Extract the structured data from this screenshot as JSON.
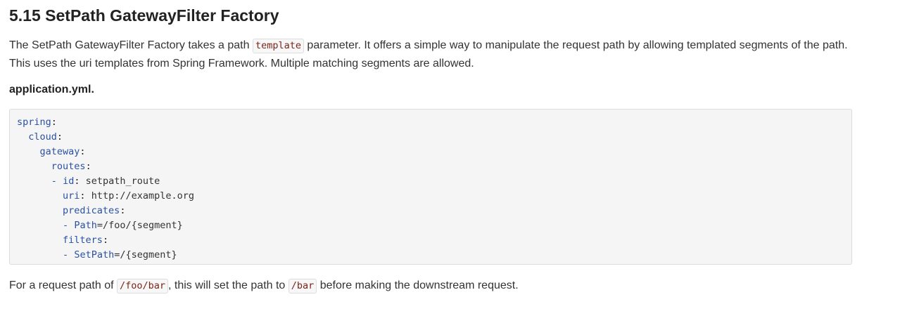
{
  "heading": "5.15 SetPath GatewayFilter Factory",
  "intro": {
    "part1": "The SetPath GatewayFilter Factory takes a path ",
    "code1": "template",
    "part2": " parameter. It offers a simple way to manipulate the request path by allowing templated segments of the path.",
    "line2": "This uses the uri templates from Spring Framework. Multiple matching segments are allowed."
  },
  "filename": "application.yml.",
  "code": {
    "spring": "spring",
    "cloud": "cloud",
    "gateway": "gateway",
    "routes": "routes",
    "id_key": "id",
    "id_val": "setpath_route",
    "uri_key": "uri",
    "uri_val": "http://example.org",
    "predicates": "predicates",
    "pred_key": "Path",
    "pred_val": "=/foo/",
    "pred_seg": "{segment}",
    "filters": "filters",
    "filter_key": "SetPath",
    "filter_val": "=/",
    "filter_seg": "{segment}"
  },
  "closing": {
    "part1": "For a request path of ",
    "code1": "/foo/bar",
    "part2": ", this will set the path to ",
    "code2": "/bar",
    "part3": " before making the downstream request."
  }
}
